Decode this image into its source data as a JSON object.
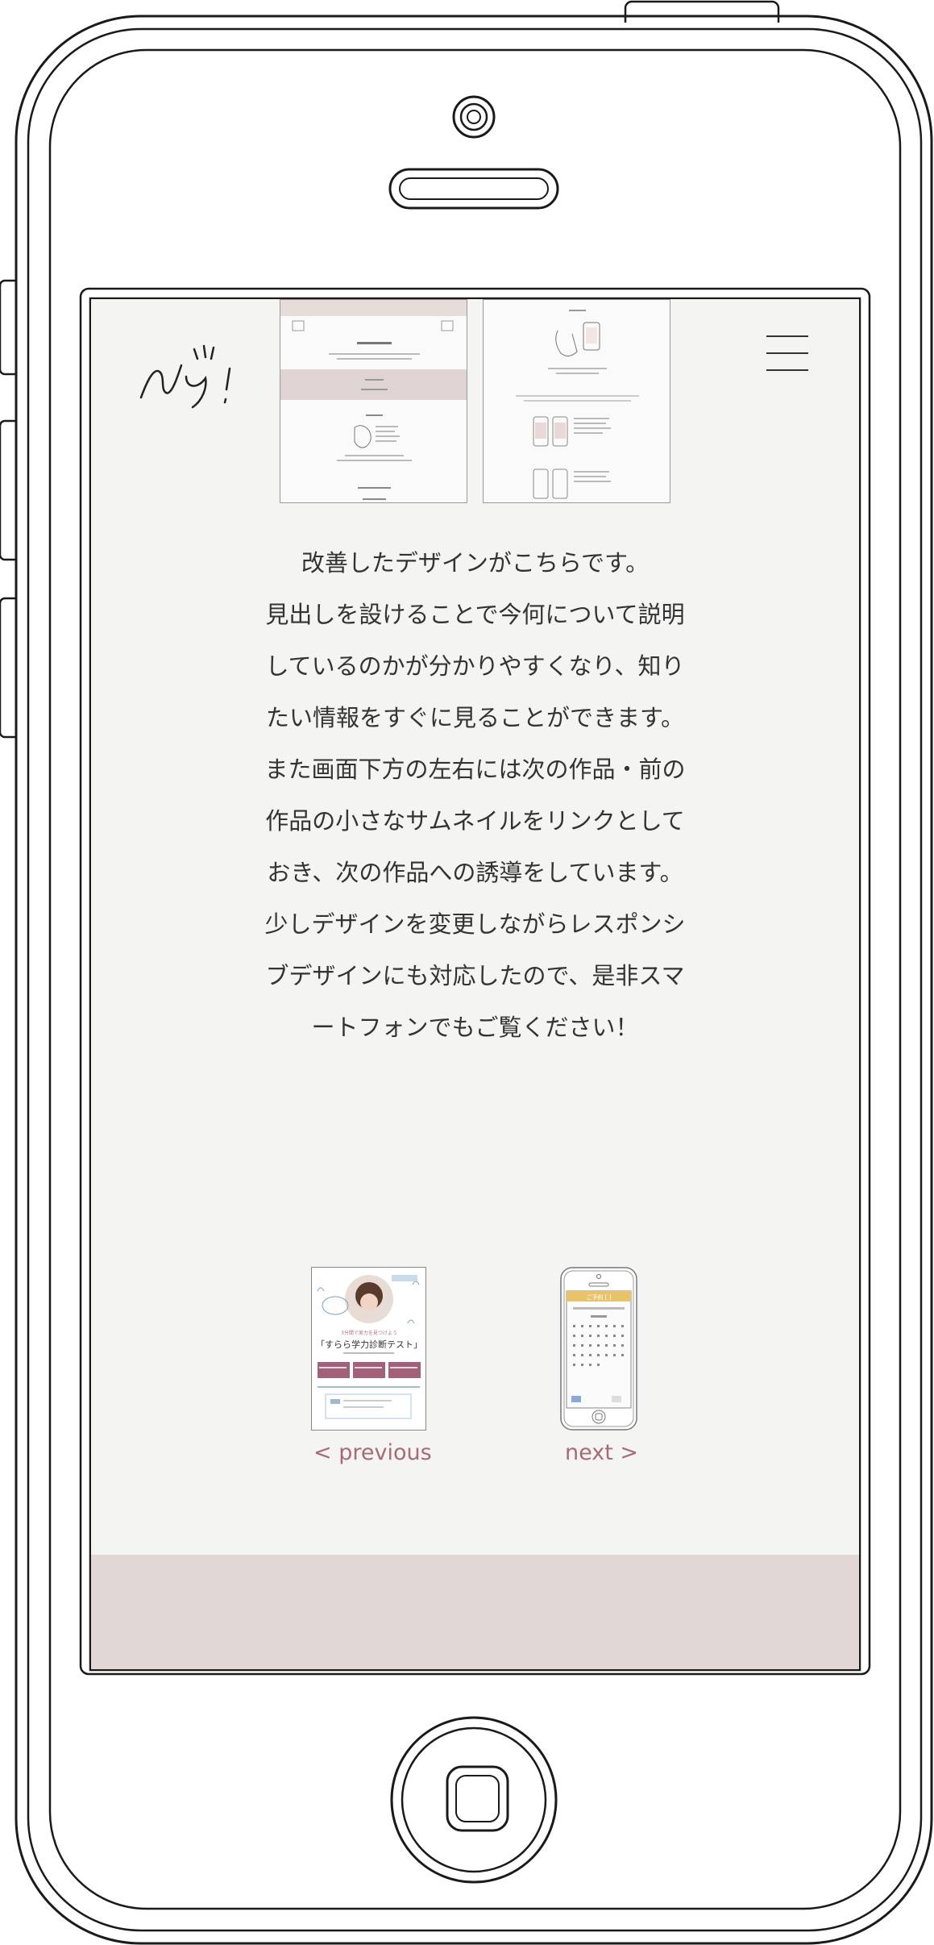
{
  "header": {
    "logo_text": "NY!",
    "menu_icon": "hamburger-icon"
  },
  "thumbnails": [
    {
      "label": "before-page-screenshot"
    },
    {
      "label": "smartphone-usage-illustration"
    }
  ],
  "description": {
    "lines": [
      "改善したデザインがこちらです。",
      "見出しを設けることで今何について説明",
      "しているのかが分かりやすくなり、知り",
      "たい情報をすぐに見ることができます。",
      "また画面下方の左右には次の作品・前の",
      "作品の小さなサムネイルをリンクとして",
      "おき、次の作品への誘導をしています。",
      "少しデザインを変更しながらレスポンシ",
      "ブデザインにも対応したので、是非スマ",
      "ートフォンでもご覧ください！"
    ]
  },
  "navigation": {
    "previous": {
      "label": "< previous",
      "thumb_title": "「すらら学力診断テスト」",
      "thumb_subtitle": "3分間で実力を見つけよう"
    },
    "next": {
      "label": "next >",
      "thumb_header": "ご予約 [ ]"
    }
  },
  "colors": {
    "screen_bg": "#f4f4f2",
    "link": "#a86b76",
    "footer_bg": "#e1d8d6",
    "accent_mauve": "#a3607a",
    "accent_gold": "#e8c36a"
  }
}
